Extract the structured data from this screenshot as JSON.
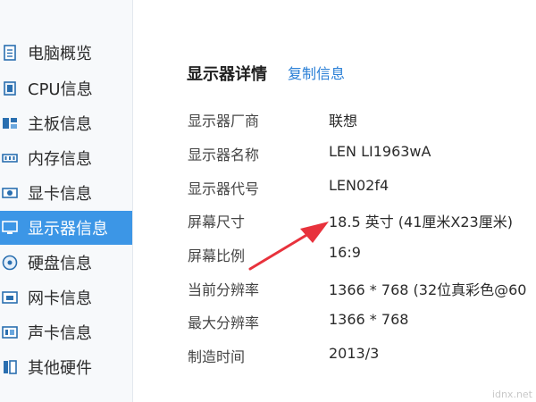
{
  "sidebar": {
    "items": [
      {
        "label": "电脑概览",
        "icon": "document-icon"
      },
      {
        "label": "CPU信息",
        "icon": "cpu-icon"
      },
      {
        "label": "主板信息",
        "icon": "motherboard-icon"
      },
      {
        "label": "内存信息",
        "icon": "memory-icon"
      },
      {
        "label": "显卡信息",
        "icon": "graphics-card-icon"
      },
      {
        "label": "显示器信息",
        "icon": "monitor-icon",
        "active": true
      },
      {
        "label": "硬盘信息",
        "icon": "disk-icon"
      },
      {
        "label": "网卡信息",
        "icon": "network-card-icon"
      },
      {
        "label": "声卡信息",
        "icon": "sound-card-icon"
      },
      {
        "label": "其他硬件",
        "icon": "hardware-icon"
      }
    ]
  },
  "main": {
    "title": "显示器详情",
    "copy_label": "复制信息",
    "rows": [
      {
        "label": "显示器厂商",
        "value": "联想"
      },
      {
        "label": "显示器名称",
        "value": "LEN LI1963wA"
      },
      {
        "label": "显示器代号",
        "value": "LEN02f4"
      },
      {
        "label": "屏幕尺寸",
        "value": "18.5 英寸 (41厘米X23厘米)"
      },
      {
        "label": "屏幕比例",
        "value": "16:9"
      },
      {
        "label": "当前分辨率",
        "value": "1366 * 768 (32位真彩色@60"
      },
      {
        "label": "最大分辨率",
        "value": "1366 * 768"
      },
      {
        "label": "制造时间",
        "value": "2013/3"
      }
    ]
  },
  "watermark": "idnx.net",
  "colors": {
    "accent": "#3c96e6",
    "link": "#2a7fd6",
    "arrow": "#e8323c"
  }
}
